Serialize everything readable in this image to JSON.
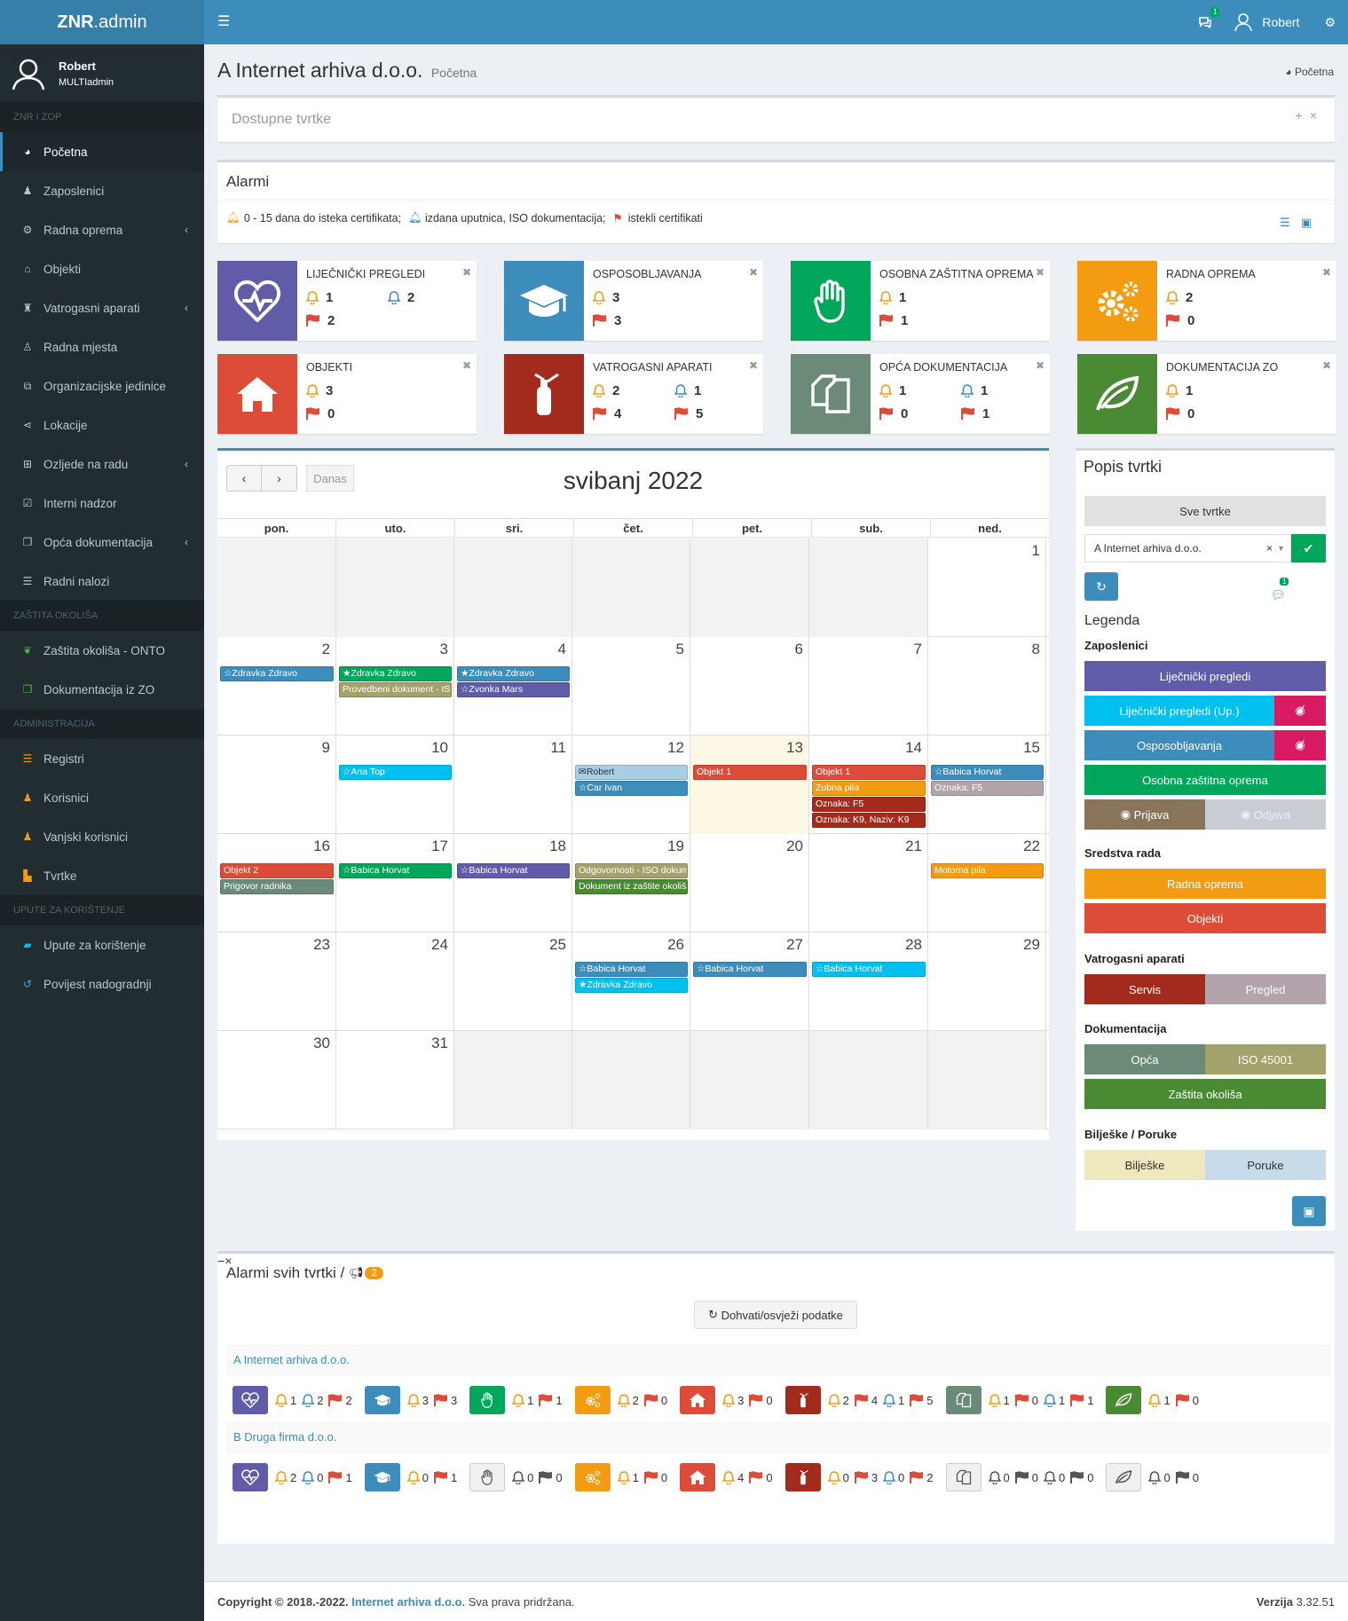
{
  "app": {
    "logo_bold": "ZNR",
    "logo_rest": ".admin"
  },
  "user": {
    "name": "Robert",
    "role": "MULTIadmin"
  },
  "topbar": {
    "notif_badge": "1",
    "user_name": "Robert"
  },
  "sidebar": {
    "section1": "ZNR i ZOP",
    "items1": [
      {
        "label": "Početna",
        "icon": "dashboard-icon"
      },
      {
        "label": "Zaposlenici",
        "icon": "users-icon"
      },
      {
        "label": "Radna oprema",
        "icon": "cogs-icon"
      },
      {
        "label": "Objekti",
        "icon": "home-icon"
      },
      {
        "label": "Vatrogasni aparati",
        "icon": "extinguisher-icon"
      },
      {
        "label": "Radna mjesta",
        "icon": "worker-icon"
      },
      {
        "label": "Organizacijske jedinice",
        "icon": "sitemap-icon"
      },
      {
        "label": "Lokacije",
        "icon": "share-icon"
      },
      {
        "label": "Ozljede na radu",
        "icon": "plus-square-icon"
      },
      {
        "label": "Interni nadzor",
        "icon": "check-square-icon"
      },
      {
        "label": "Opća dokumentacija",
        "icon": "copy-icon"
      },
      {
        "label": "Radni nalozi",
        "icon": "list-icon"
      }
    ],
    "section2": "ZAŠTITA OKOLIŠA",
    "items2": [
      {
        "label": "Zaštita okoliša - ONTO"
      },
      {
        "label": "Dokumentacija iz ZO"
      }
    ],
    "section3": "ADMINISTRACIJA",
    "items3": [
      {
        "label": "Registri"
      },
      {
        "label": "Korisnici"
      },
      {
        "label": "Vanjski korisnici"
      },
      {
        "label": "Tvrtke"
      }
    ],
    "section4": "UPUTE ZA KORIŠTENJE",
    "items4": [
      {
        "label": "Upute za korištenje"
      },
      {
        "label": "Povijest nadogradnji"
      }
    ]
  },
  "page": {
    "title": "A Internet arhiva d.o.o.",
    "subtitle": "Početna",
    "breadcrumb": "Početna"
  },
  "box_tvrtke": {
    "title": "Dostupne tvrtke"
  },
  "box_alarmi": {
    "title": "Alarmi",
    "legend1": "0 - 15 dana do isteka certifikata;",
    "legend2": "izdana uputnica, ISO dokumentacija;",
    "legend3": "istekli certifikati"
  },
  "infoboxes": [
    {
      "title": "LIJEČNIČKI PREGLEDI",
      "color": "#605ca8",
      "icon": "heartbeat-icon",
      "a": "1",
      "b": "2",
      "c": "2",
      "d": ""
    },
    {
      "title": "OSPOSOBLJAVANJA",
      "color": "#3c8dbc",
      "icon": "graduation-cap-icon",
      "a": "3",
      "b": "",
      "c": "3",
      "d": ""
    },
    {
      "title": "OSOBNA ZAŠTITNA OPREMA",
      "color": "#00a65a",
      "icon": "hand-icon",
      "a": "1",
      "b": "",
      "c": "1",
      "d": ""
    },
    {
      "title": "RADNA OPREMA",
      "color": "#f39c12",
      "icon": "cogs-icon",
      "a": "2",
      "b": "",
      "c": "0",
      "d": ""
    },
    {
      "title": "OBJEKTI",
      "color": "#dd4b39",
      "icon": "home-icon",
      "a": "3",
      "b": "",
      "c": "0",
      "d": ""
    },
    {
      "title": "VATROGASNI APARATI",
      "color": "#a32b1e",
      "icon": "extinguisher-icon",
      "a": "2",
      "b": "1",
      "c": "4",
      "d": "5"
    },
    {
      "title": "OPĆA DOKUMENTACIJA",
      "color": "#6b8a78",
      "icon": "copy-icon",
      "a": "1",
      "b": "1",
      "c": "0",
      "d": "1"
    },
    {
      "title": "DOKUMENTACIJA ZO",
      "color": "#4a8a32",
      "icon": "leaf-icon",
      "a": "1",
      "b": "",
      "c": "0",
      "d": ""
    }
  ],
  "calendar": {
    "title": "svibanj 2022",
    "today_label": "Danas",
    "days": [
      "pon.",
      "uto.",
      "sri.",
      "čet.",
      "pet.",
      "sub.",
      "ned."
    ],
    "weeks": [
      [
        "",
        "",
        "",
        "",
        "",
        "",
        "1"
      ],
      [
        "2",
        "3",
        "4",
        "5",
        "6",
        "7",
        "8"
      ],
      [
        "9",
        "10",
        "11",
        "12",
        "13",
        "14",
        "15"
      ],
      [
        "16",
        "17",
        "18",
        "19",
        "20",
        "21",
        "22"
      ],
      [
        "23",
        "24",
        "25",
        "26",
        "27",
        "28",
        "29"
      ],
      [
        "30",
        "31",
        "",
        "",
        "",
        "",
        ""
      ]
    ],
    "events": [
      {
        "w": 1,
        "d": 0,
        "s": 0,
        "t": "Zdravka Zdravo",
        "c": "#3c8dbc",
        "i": "☆"
      },
      {
        "w": 1,
        "d": 1,
        "s": 0,
        "t": "Zdravka Zdravo",
        "c": "#00a65a",
        "i": "★"
      },
      {
        "w": 1,
        "d": 1,
        "s": 1,
        "t": "Provedbeni dokument - ISO",
        "c": "#a3a26a",
        "i": ""
      },
      {
        "w": 1,
        "d": 2,
        "s": 0,
        "t": "Zdravka Zdravo",
        "c": "#3c8dbc",
        "i": "★"
      },
      {
        "w": 1,
        "d": 2,
        "s": 1,
        "t": "Zvonka Mars",
        "c": "#605ca8",
        "i": "☆"
      },
      {
        "w": 2,
        "d": 1,
        "s": 0,
        "t": "Ana Top",
        "c": "#00c0ef",
        "i": "☆"
      },
      {
        "w": 2,
        "d": 3,
        "s": 0,
        "t": "Robert",
        "c": "#a9cde3",
        "i": "✉",
        "dark": true
      },
      {
        "w": 2,
        "d": 3,
        "s": 1,
        "t": "Car Ivan",
        "c": "#3c8dbc",
        "i": "☆"
      },
      {
        "w": 2,
        "d": 4,
        "s": 0,
        "t": "Objekt 1",
        "c": "#dd4b39",
        "i": ""
      },
      {
        "w": 2,
        "d": 5,
        "s": 0,
        "t": "Objekt 1",
        "c": "#dd4b39",
        "i": ""
      },
      {
        "w": 2,
        "d": 5,
        "s": 1,
        "t": "Zubna pila",
        "c": "#f39c12",
        "i": ""
      },
      {
        "w": 2,
        "d": 5,
        "s": 2,
        "t": "Oznaka: F5",
        "c": "#a32b1e",
        "i": ""
      },
      {
        "w": 2,
        "d": 5,
        "s": 3,
        "t": "Oznaka: K9, Naziv: K9",
        "c": "#a32b1e",
        "i": ""
      },
      {
        "w": 2,
        "d": 6,
        "s": 0,
        "t": "Babica Horvat",
        "c": "#3c8dbc",
        "i": "☆"
      },
      {
        "w": 2,
        "d": 6,
        "s": 1,
        "t": "Oznaka: F5",
        "c": "#b3a3aa",
        "i": ""
      },
      {
        "w": 3,
        "d": 0,
        "s": 0,
        "t": "Objekt 2",
        "c": "#dd4b39",
        "i": ""
      },
      {
        "w": 3,
        "d": 0,
        "s": 1,
        "t": "Prigovor radnika",
        "c": "#6b8a78",
        "i": ""
      },
      {
        "w": 3,
        "d": 1,
        "s": 0,
        "t": "Babica Horvat",
        "c": "#00a65a",
        "i": "☆"
      },
      {
        "w": 3,
        "d": 2,
        "s": 0,
        "t": "Babica Horvat",
        "c": "#605ca8",
        "i": "☆"
      },
      {
        "w": 3,
        "d": 3,
        "s": 0,
        "t": "Odgovornosti - ISO dokum.",
        "c": "#a3a26a",
        "i": ""
      },
      {
        "w": 3,
        "d": 3,
        "s": 1,
        "t": "Dokument iz zaštite okoliša",
        "c": "#4a8a32",
        "i": ""
      },
      {
        "w": 3,
        "d": 6,
        "s": 0,
        "t": "Motorna pila",
        "c": "#f39c12",
        "i": ""
      },
      {
        "w": 4,
        "d": 3,
        "s": 0,
        "t": "Babica Horvat",
        "c": "#3c8dbc",
        "i": "☆"
      },
      {
        "w": 4,
        "d": 3,
        "s": 1,
        "t": "Zdravka Zdravo",
        "c": "#00c0ef",
        "i": "★"
      },
      {
        "w": 4,
        "d": 4,
        "s": 0,
        "t": "Babica Horvat",
        "c": "#3c8dbc",
        "i": "☆"
      },
      {
        "w": 4,
        "d": 5,
        "s": 0,
        "t": "Babica Horvat",
        "c": "#00c0ef",
        "i": "☆"
      }
    ]
  },
  "popis": {
    "title": "Popis tvrtki",
    "all_button": "Sve tvrtke",
    "selected": "A Internet arhiva d.o.o.",
    "badge": "1",
    "legend_title": "Legenda",
    "g1": "Zaposlenici",
    "g1_items": [
      "Liječnički pregledi",
      "Liječnički pregledi (Up.)",
      "Osposobljavanja",
      "Osobna zaštitna oprema"
    ],
    "prijava": "Prijava",
    "odjava": "Odjava",
    "g2": "Sredstva rada",
    "g2_items": [
      "Radna oprema",
      "Objekti"
    ],
    "g3": "Vatrogasni aparati",
    "servis": "Servis",
    "pregled": "Pregled",
    "g4": "Dokumentacija",
    "opca": "Opća",
    "iso": "ISO 45001",
    "zo": "Zaštita okoliša",
    "g5": "Bilješke / Poruke",
    "biljeske": "Bilješke",
    "poruke": "Poruke"
  },
  "alarmi_svih": {
    "title": "Alarmi svih tvrtki /",
    "badge": "2",
    "refresh": "Dohvati/osvježi podatke",
    "companies": [
      {
        "name": "A Internet arhiva d.o.o.",
        "vals": [
          "1",
          "2",
          "2",
          "3",
          "3",
          "1",
          "1",
          "2",
          "0",
          "3",
          "0",
          "2",
          "4",
          "1",
          "5",
          "1",
          "0",
          "1",
          "1",
          "1",
          "0"
        ]
      },
      {
        "name": "B Druga firma d.o.o.",
        "vals": [
          "2",
          "0",
          "1",
          "0",
          "1",
          "0",
          "0",
          "1",
          "0",
          "4",
          "0",
          "0",
          "3",
          "0",
          "2",
          "0",
          "0",
          "0",
          "0",
          "0",
          "0"
        ]
      }
    ]
  },
  "footer": {
    "copy": "Copyright © 2018.-2022.",
    "company": "Internet arhiva d.o.o.",
    "rights": "Sva prava pridržana.",
    "ver_label": "Verzija",
    "ver": "3.32.51"
  }
}
